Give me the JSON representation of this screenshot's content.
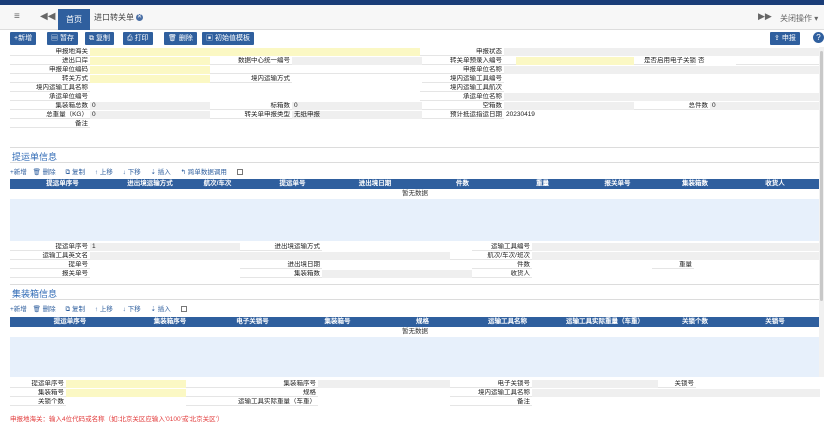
{
  "tabs": {
    "home": "首页",
    "active": "进口转关单",
    "close_ops": "关闭操作"
  },
  "toolbar": {
    "new": "+新增",
    "save": "暂存",
    "copy": "复制",
    "print": "打印",
    "delete": "删除",
    "init_template": "初始值模板",
    "declare": "申报",
    "help": "?"
  },
  "form": {
    "r1": {
      "l1": "申报地海关",
      "l2": "申报状态"
    },
    "r2": {
      "l1": "进出口岸",
      "l2": "数据中心统一编号",
      "l3": "转关单预录入编号",
      "l4": "是否启用电子关锁",
      "v4": "否"
    },
    "r3": {
      "l1": "申报单位编码",
      "l2": "申报单位名称"
    },
    "r4": {
      "l1": "转关方式",
      "l2": "境内运输方式",
      "l3": "境内运输工具编号"
    },
    "r5": {
      "l1": "境内运输工具名称",
      "l2": "境内运输工具航次"
    },
    "r6": {
      "l1": "承运单位编号",
      "l2": "承运单位名称"
    },
    "r7": {
      "l1": "集装箱总数",
      "v1": "0",
      "l2": "标箱数",
      "v2": "0",
      "l3": "空箱数",
      "l4": "总件数",
      "v4": "0"
    },
    "r8": {
      "l1": "总重量（KG）",
      "v1": "0",
      "l2": "转关单申报类型",
      "v2": "无纸申报",
      "l3": "预计抵运指运日期",
      "v3": "20230419"
    },
    "r9": {
      "l1": "备注"
    }
  },
  "bill": {
    "title": "提运单信息",
    "bar": {
      "new": "+新增",
      "delete": "删除",
      "copy": "复制",
      "up": "上移",
      "down": "下移",
      "insert": "插入",
      "cross": "跨单数据调用"
    },
    "headers": [
      "提运单序号",
      "进出境运输方式",
      "航次/车次",
      "提运单号",
      "进出境日期",
      "件数",
      "重量",
      "报关单号",
      "集装箱数",
      "收货人"
    ],
    "nodata": "暂无数据",
    "f": {
      "a1": "提运单序号",
      "av1": "1",
      "a2": "进出境运输方式",
      "a3": "运输工具编号",
      "b1": "运输工具英文名",
      "b3": "航次/车次/班次",
      "c1": "提单号",
      "c2": "进出境日期",
      "c3": "件数",
      "c4": "重量",
      "d1": "报关单号",
      "d2": "集装箱数",
      "d3": "收货人"
    }
  },
  "container": {
    "title": "集装箱信息",
    "bar": {
      "new": "+新增",
      "delete": "删除",
      "copy": "复制",
      "up": "上移",
      "down": "下移",
      "insert": "插入"
    },
    "headers": [
      "提运单序号",
      "集装箱序号",
      "电子关锁号",
      "集装箱号",
      "规格",
      "运输工具名称",
      "运输工具实际重量（车重）",
      "关锁个数",
      "关锁号"
    ],
    "nodata": "暂无数据",
    "f": {
      "a1": "提运单序号",
      "a2": "集装箱序号",
      "a3": "电子关锁号",
      "a4": "关锁号",
      "b1": "集装箱号",
      "b2": "规格",
      "b3": "境内运输工具名称",
      "c1": "关锁个数",
      "c2": "运输工具实际重量（车重）",
      "c3": "备注"
    }
  },
  "footer": "申报地海关：输入4位代码或名称（如:北京关区应输入'0100'或'北京关区'）"
}
